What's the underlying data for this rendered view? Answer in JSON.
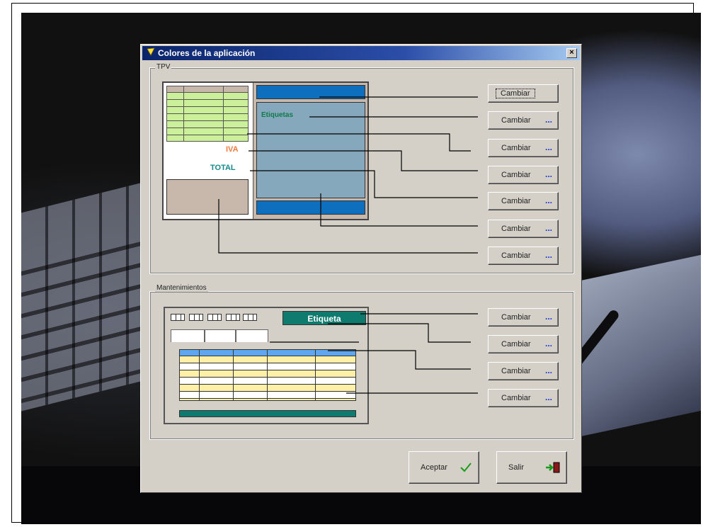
{
  "dialog": {
    "title": "Colores de la aplicación",
    "close_glyph": "×"
  },
  "tpv": {
    "group_label": "TPV",
    "preview": {
      "iva_label": "IVA",
      "total_label": "TOTAL",
      "etiquetas_label": "Etiquetas"
    },
    "buttons": [
      {
        "label": "Cambiar",
        "dots": "..."
      },
      {
        "label": "Cambiar",
        "dots": "..."
      },
      {
        "label": "Cambiar",
        "dots": "..."
      },
      {
        "label": "Cambiar",
        "dots": "..."
      },
      {
        "label": "Cambiar",
        "dots": "..."
      },
      {
        "label": "Cambiar",
        "dots": "..."
      },
      {
        "label": "Cambiar",
        "dots": "..."
      }
    ]
  },
  "mantenimientos": {
    "group_label": "Mantenimientos",
    "preview": {
      "etiqueta_label": "Etiqueta"
    },
    "buttons": [
      {
        "label": "Cambiar",
        "dots": "..."
      },
      {
        "label": "Cambiar",
        "dots": "..."
      },
      {
        "label": "Cambiar",
        "dots": "..."
      },
      {
        "label": "Cambiar",
        "dots": "..."
      }
    ]
  },
  "footer": {
    "accept_label": "Aceptar",
    "exit_label": "Salir"
  },
  "colors": {
    "title_bar": "#0a246a",
    "dialog_face": "#d4d0c8",
    "accept_check": "#1a9a1a",
    "exit_icon": "#1a9a1a"
  }
}
